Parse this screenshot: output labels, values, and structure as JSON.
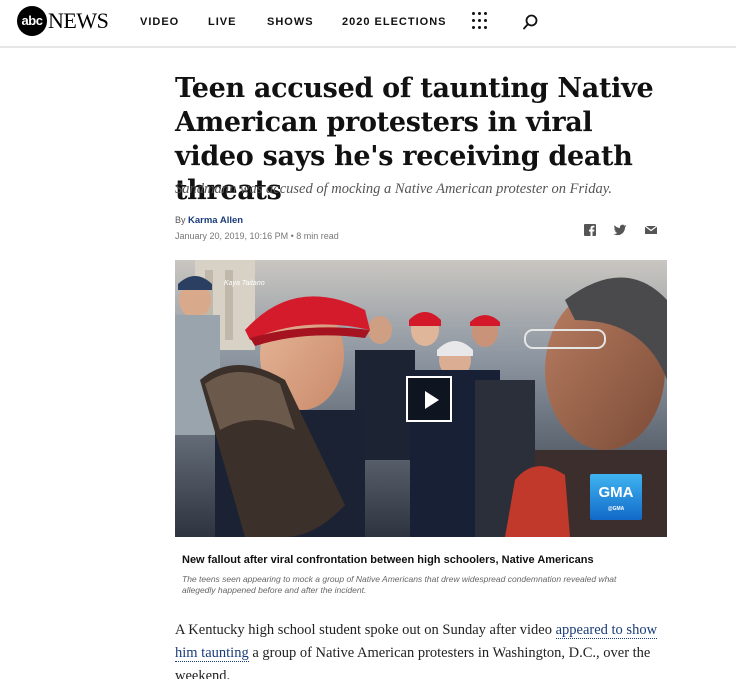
{
  "header": {
    "logo_mark": "abc",
    "logo_text": "NEWS",
    "nav": [
      "VIDEO",
      "LIVE",
      "SHOWS",
      "2020 ELECTIONS"
    ],
    "icons": [
      "grid-menu-icon",
      "search-icon"
    ]
  },
  "article": {
    "headline": "Teen accused of taunting Native American protesters in viral video says he's receiving death threats",
    "subhead": "Sandmann was accused of mocking a Native American protester on Friday.",
    "by_prefix": "By ",
    "author": "Karma Allen",
    "date": "January 20, 2019, 10:16 PM",
    "read_time": "8 min read",
    "share_icons": [
      "facebook-icon",
      "twitter-icon",
      "email-icon"
    ]
  },
  "video": {
    "credit": "Kaya Taitano",
    "gma_label": "GMA",
    "gma_sub": "@GMA",
    "caption_title": "New fallout after viral confrontation between high schoolers, Native Americans",
    "caption_desc": "The teens seen appearing to mock a group of Native Americans that drew widespread condemnation revealed what allegedly happened before and after the incident."
  },
  "body": {
    "p1_before": "A Kentucky high school student spoke out on Sunday after video ",
    "p1_link": "appeared to show him taunting",
    "p1_after": " a group of Native American protesters in Washington, D.C., over the weekend."
  },
  "colors": {
    "link": "#1a3c78",
    "divider": "#e6e6e6",
    "gma_blue": "#1a83dc"
  }
}
